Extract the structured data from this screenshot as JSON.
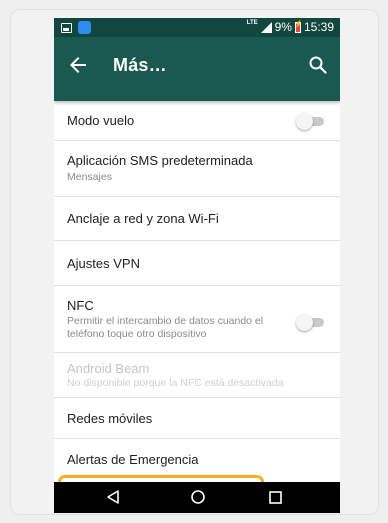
{
  "status_bar": {
    "network_type": "LTE",
    "battery_level": "9%",
    "time": "15:39"
  },
  "app_bar": {
    "title": "Más…"
  },
  "settings": [
    {
      "id": "airplane",
      "label": "Modo vuelo",
      "toggle": "off"
    },
    {
      "id": "sms",
      "label": "Aplicación SMS predeterminada",
      "subtitle": "Mensajes"
    },
    {
      "id": "tethering",
      "label": "Anclaje a red y zona Wi-Fi"
    },
    {
      "id": "vpn",
      "label": "Ajustes VPN"
    },
    {
      "id": "nfc",
      "label": "NFC",
      "subtitle": "Permitir el intercambio de datos cuando el teléfono toque otro dispositivo",
      "toggle": "off"
    },
    {
      "id": "beam",
      "label": "Android Beam",
      "subtitle": "No disponible porque la NFC está desactivada",
      "disabled": true
    },
    {
      "id": "mobile",
      "label": "Redes móviles",
      "highlighted": true
    },
    {
      "id": "alerts",
      "label": "Alertas de Emergencia"
    }
  ],
  "colors": {
    "status_bar": "#11473f",
    "app_bar": "#19594f",
    "highlight": "#f3b21b"
  },
  "nav_icons": [
    "back-triangle-icon",
    "home-circle-icon",
    "recents-square-icon"
  ]
}
